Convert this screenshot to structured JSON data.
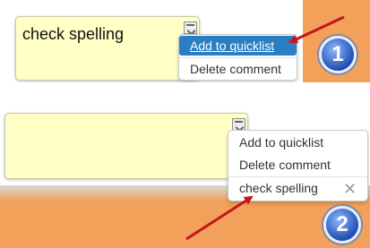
{
  "step1": {
    "note_text": "check spelling",
    "menu": [
      "Add to quicklist",
      "Delete comment"
    ],
    "badge": "1",
    "grip_icon": "resize-grip-icon"
  },
  "step2": {
    "menu": [
      "Add to quicklist",
      "Delete comment"
    ],
    "quicklist_item": "check spelling",
    "remove_glyph": "✕",
    "badge": "2",
    "grip_icon": "resize-grip-icon"
  },
  "colors": {
    "orange": "#f2a05a",
    "note": "#ffffc6",
    "highlight": "#2a7ec2",
    "arrow": "#c4161c"
  }
}
